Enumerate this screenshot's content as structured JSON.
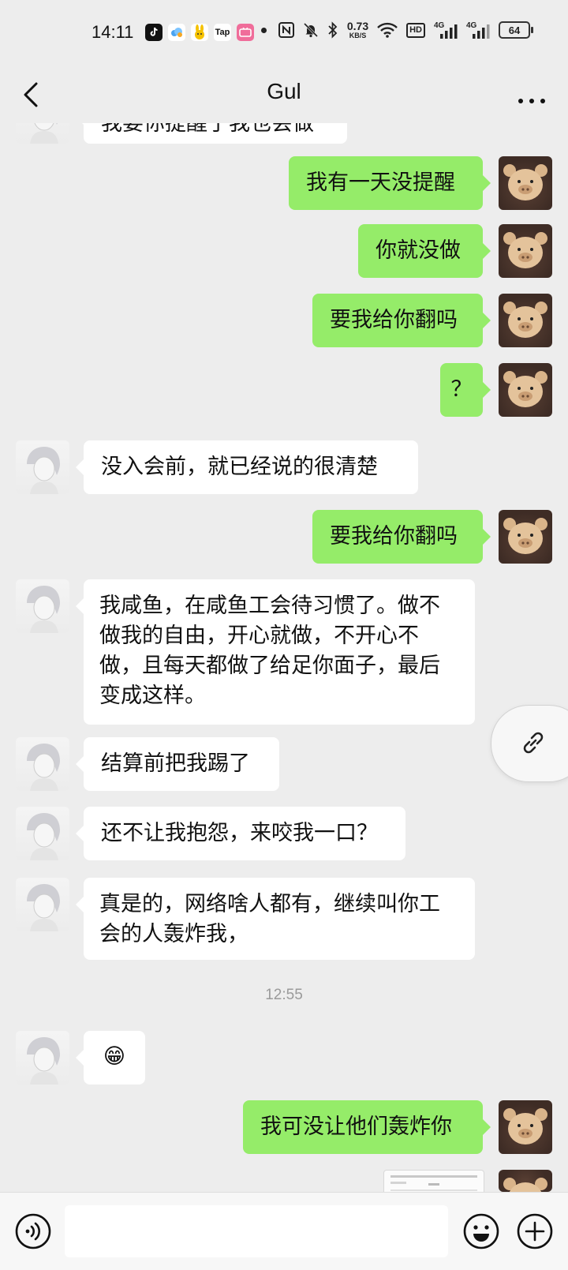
{
  "status_bar": {
    "time": "14:11",
    "app_icons": [
      "tiktok-icon",
      "cloud-app-icon",
      "rabbit-app-icon",
      "taptap-icon",
      "bilibili-icon"
    ],
    "taptap_label": "Tap",
    "net_speed_value": "0.73",
    "net_speed_unit": "KB/S",
    "hd_label": "HD",
    "signal1_label": "4G",
    "signal2_label": "4G",
    "battery": "64"
  },
  "header": {
    "title": "Gul"
  },
  "messages": [
    {
      "side": "left",
      "text": "我要你提醒了我也会做"
    },
    {
      "side": "right",
      "text": "我有一天没提醒"
    },
    {
      "side": "right",
      "text": "你就没做"
    },
    {
      "side": "right",
      "text": "要我给你翻吗"
    },
    {
      "side": "right",
      "text": "？"
    },
    {
      "side": "left",
      "text": "没入会前，就已经说的很清楚"
    },
    {
      "side": "right",
      "text": "要我给你翻吗"
    },
    {
      "side": "left",
      "text": "我咸鱼，在咸鱼工会待习惯了。做不做我的自由，开心就做，不开心不做，且每天都做了给足你面子，最后变成这样。"
    },
    {
      "side": "left",
      "text": "结算前把我踢了"
    },
    {
      "side": "left",
      "text": "还不让我抱怨，来咬我一口？"
    },
    {
      "side": "left",
      "text": "真是的，网络啥人都有，继续叫你工会的人轰炸我，"
    },
    {
      "side": "left",
      "text": "😁"
    },
    {
      "side": "right",
      "text": "我可没让他们轰炸你"
    }
  ],
  "timestamp": "12:55",
  "input_bar": {
    "placeholder": ""
  },
  "colors": {
    "background": "#ededed",
    "bubble_self": "#95ec69",
    "bubble_other": "#ffffff",
    "timestamp": "#9a9a9a"
  }
}
